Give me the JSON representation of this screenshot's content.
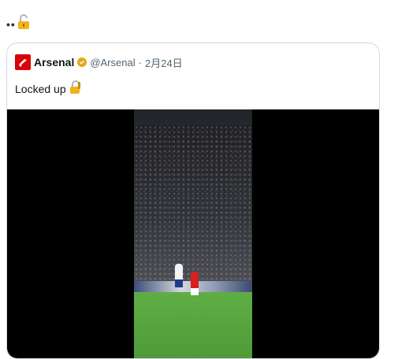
{
  "top": {
    "dots": "••",
    "emoji_icon": "unlocked-padlock-icon"
  },
  "quote": {
    "account_name": "Arsenal",
    "handle": "@Arsenal",
    "separator": "·",
    "date": "2月24日",
    "text": "Locked up",
    "text_emoji_icon": "locked-padlock-with-key-icon",
    "avatar_icon": "arsenal-crest-icon",
    "verified_icon": "gold-verified-badge-icon"
  },
  "colors": {
    "avatar_red": "#db0007",
    "verified_gold": "#e8a517",
    "muted": "#536471",
    "border": "#cfd9de"
  }
}
